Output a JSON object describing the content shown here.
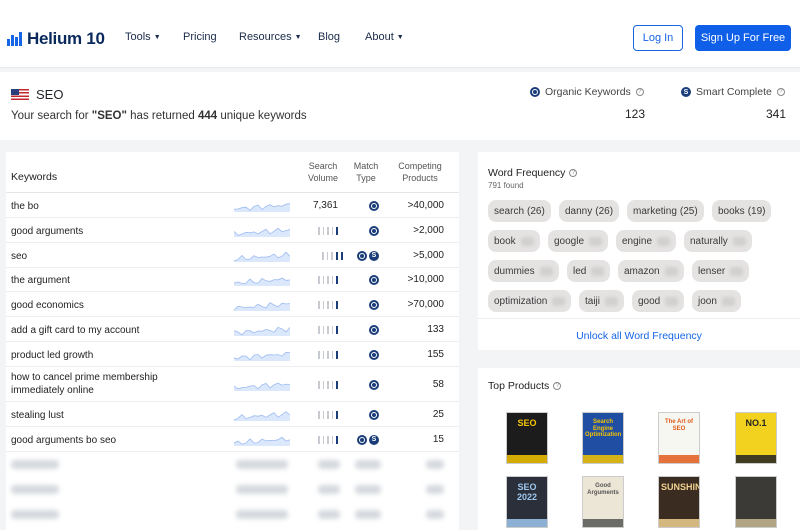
{
  "nav": {
    "logo": "Helium 10",
    "items": [
      "Tools",
      "Pricing",
      "Resources",
      "Blog",
      "About"
    ],
    "login": "Log In",
    "signup": "Sign Up For Free"
  },
  "search": {
    "query": "SEO",
    "message_prefix": "Your search for ",
    "message_query": "\"SEO\"",
    "message_mid": " has returned ",
    "message_count": "444",
    "message_suffix": " unique keywords",
    "organic_label": "Organic Keywords",
    "organic_value": "123",
    "smart_label": "Smart Complete",
    "smart_value": "341"
  },
  "table": {
    "headers": {
      "keywords": "Keywords",
      "search_volume": "Search Volume",
      "match_type": "Match Type",
      "competing": "Competing Products"
    },
    "rows": [
      {
        "keyword": "the bo",
        "volume": "7,361",
        "bars": 0,
        "match": [
          "O"
        ],
        "competing": ">40,000"
      },
      {
        "keyword": "good arguments",
        "volume": "",
        "bars": 1,
        "match": [
          "O"
        ],
        "competing": ">2,000"
      },
      {
        "keyword": "seo",
        "volume": "",
        "bars": 2,
        "match": [
          "O",
          "S"
        ],
        "competing": ">5,000"
      },
      {
        "keyword": "the argument",
        "volume": "",
        "bars": 1,
        "match": [
          "O"
        ],
        "competing": ">10,000"
      },
      {
        "keyword": "good economics",
        "volume": "",
        "bars": 1,
        "match": [
          "O"
        ],
        "competing": ">70,000"
      },
      {
        "keyword": "add a gift card to my account",
        "volume": "",
        "bars": 1,
        "match": [
          "O"
        ],
        "competing": "133"
      },
      {
        "keyword": "product led growth",
        "volume": "",
        "bars": 1,
        "match": [
          "O"
        ],
        "competing": "155"
      },
      {
        "keyword": "how to cancel prime membership immediately online",
        "volume": "",
        "bars": 1,
        "match": [
          "O"
        ],
        "competing": "58"
      },
      {
        "keyword": "stealing lust",
        "volume": "",
        "bars": 1,
        "match": [
          "O"
        ],
        "competing": "25"
      },
      {
        "keyword": "good arguments bo seo",
        "volume": "",
        "bars": 1,
        "match": [
          "O",
          "S"
        ],
        "competing": "15"
      }
    ]
  },
  "word_frequency": {
    "title": "Word Frequency",
    "found": "791 found",
    "words": [
      {
        "word": "search",
        "count": "(26)"
      },
      {
        "word": "danny",
        "count": "(26)"
      },
      {
        "word": "marketing",
        "count": "(25)"
      },
      {
        "word": "books",
        "count": "(19)"
      },
      {
        "word": "book",
        "count": ""
      },
      {
        "word": "google",
        "count": ""
      },
      {
        "word": "engine",
        "count": ""
      },
      {
        "word": "naturally",
        "count": ""
      },
      {
        "word": "dummies",
        "count": ""
      },
      {
        "word": "led",
        "count": ""
      },
      {
        "word": "amazon",
        "count": ""
      },
      {
        "word": "lenser",
        "count": ""
      },
      {
        "word": "optimization",
        "count": ""
      },
      {
        "word": "taiji",
        "count": ""
      },
      {
        "word": "good",
        "count": ""
      },
      {
        "word": "joon",
        "count": ""
      }
    ],
    "unlock": "Unlock all Word Frequency"
  },
  "top_products": {
    "title": "Top Products",
    "books": [
      {
        "cover_text": "SEO",
        "bg": "#1c1c1c",
        "accent": "#f5c400"
      },
      {
        "cover_text": "Search Engine Optimization",
        "bg": "#1f4ea3",
        "accent": "#f5c400"
      },
      {
        "cover_text": "The Art of SEO",
        "bg": "#f7f7f2",
        "accent": "#e05a1a"
      },
      {
        "cover_text": "NO.1",
        "bg": "#f2d21e",
        "accent": "#222222"
      },
      {
        "cover_text": "SEO 2022",
        "bg": "#2a2f3a",
        "accent": "#9ec7ef"
      },
      {
        "cover_text": "Good Arguments",
        "bg": "#ece6d6",
        "accent": "#555555"
      },
      {
        "cover_text": "SUNSHINE",
        "bg": "#3a2c20",
        "accent": "#f0d090"
      },
      {
        "cover_text": "",
        "bg": "#3b3a36",
        "accent": "#c8b890"
      }
    ]
  }
}
